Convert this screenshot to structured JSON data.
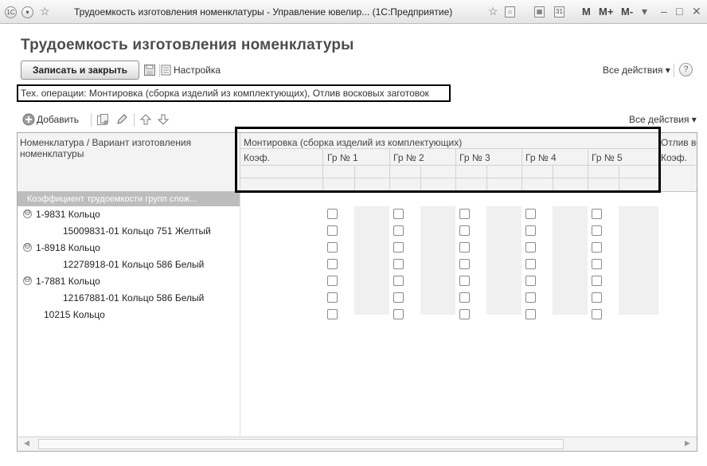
{
  "window": {
    "title": "Трудоемкость изготовления номенклатуры - Управление ювелир... (1С:Предприятие)",
    "m_buttons": [
      "M",
      "M+",
      "M-"
    ],
    "app_icon": "1c-logo-icon"
  },
  "header": {
    "page_title": "Трудоемкость изготовления номенклатуры",
    "save_close_label": "Записать и закрыть",
    "settings_label": "Настройка",
    "all_actions_label": "Все действия ▾",
    "help_label": "?"
  },
  "operations_text": "Тех. операции: Монтировка (сборка изделий из комплектующих), Отлив восковых заготовок",
  "toolbar": {
    "add_label": "Добавить",
    "all_actions_label": "Все действия ▾"
  },
  "grid": {
    "col_item_header": "Номенклатура / Вариант изготовления номенклатуры",
    "group1_header": "Монтировка (сборка изделий из комплектующих)",
    "group2_header": "Отлив во",
    "coef_label": "Коэф.",
    "groups": [
      "Гр № 1",
      "Гр № 2",
      "Гр № 3",
      "Гр № 4",
      "Гр № 5"
    ],
    "coef_row_label": "Коэффициент трудоемкости групп слож...",
    "rows": [
      {
        "label": "1-9831 Кольцо",
        "level": 0,
        "expander": "⊖"
      },
      {
        "label": "15009831-01 Кольцо 751 Желтый",
        "level": 1,
        "expander": ""
      },
      {
        "label": "1-8918 Кольцо",
        "level": 0,
        "expander": "⊖"
      },
      {
        "label": "12278918-01 Кольцо 586 Белый",
        "level": 1,
        "expander": ""
      },
      {
        "label": "1-7881 Кольцо",
        "level": 0,
        "expander": "⊖"
      },
      {
        "label": "12167881-01 Кольцо 586 Белый",
        "level": 1,
        "expander": ""
      },
      {
        "label": "10215 Кольцо",
        "level": 0,
        "expander": ""
      }
    ]
  },
  "colors": {
    "highlight_border": "#000000",
    "coef_row_bg": "#bdbdbd"
  }
}
